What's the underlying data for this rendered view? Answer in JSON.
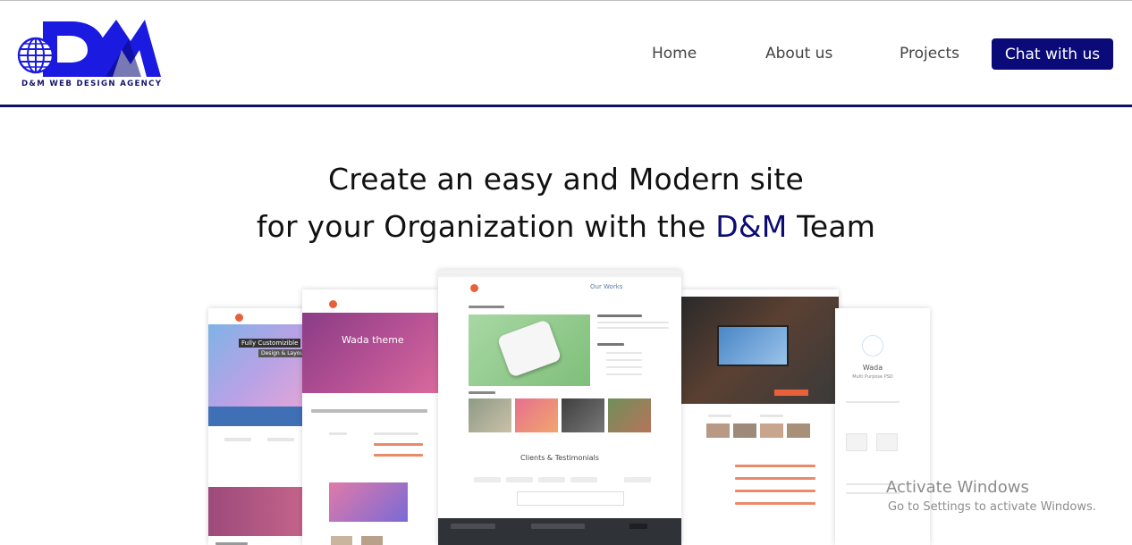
{
  "brand": {
    "logo_letters": "D&M",
    "logo_tagline": "D&M WEB DESIGN AGENCY",
    "primary_color": "#0a0a78",
    "accent_color": "#1a1ae0"
  },
  "nav": {
    "items": [
      {
        "label": "Home"
      },
      {
        "label": "About us"
      },
      {
        "label": "Projects"
      }
    ],
    "cta_label": "Chat with us"
  },
  "hero": {
    "line1": "Create an easy and Modern site",
    "line2_before": "for your Organization with the ",
    "line2_accent": "D&M",
    "line2_after": " Team"
  },
  "showcase": {
    "theme_name": "Wada theme",
    "headline_left": "Fully Customizible",
    "subline_left": "Design & Layout",
    "section_clients": "Clients & Testimonials",
    "section_our_works": "Our Works",
    "right_brand": "Wada",
    "right_sub": "Multi Purpose PSD"
  },
  "watermark": {
    "title": "Activate Windows",
    "subtitle": "Go to Settings to activate Windows."
  }
}
